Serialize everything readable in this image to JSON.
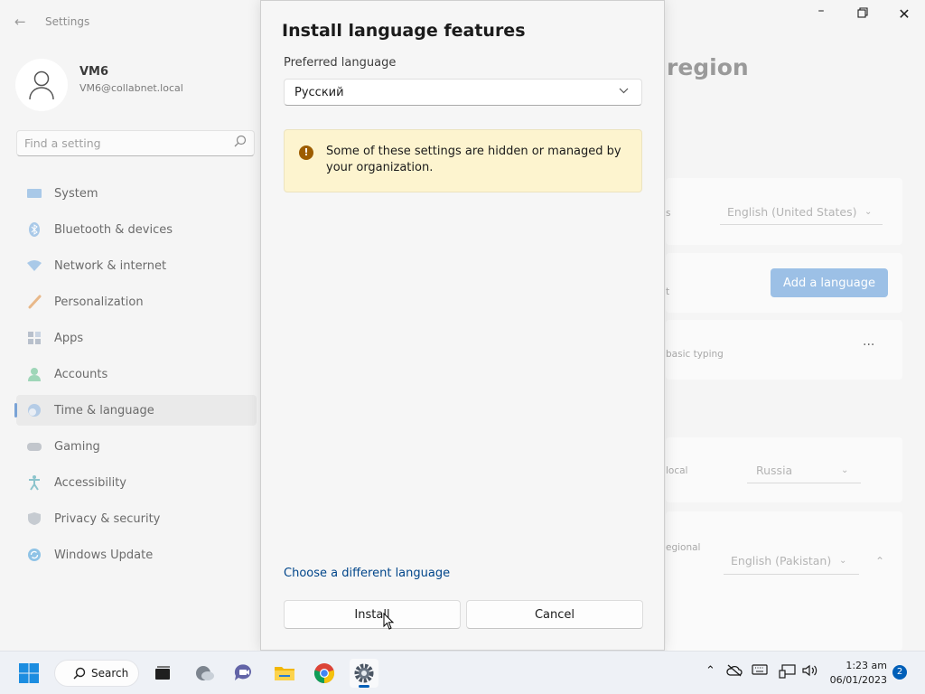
{
  "settings": {
    "app_title": "Settings",
    "user": {
      "name": "VM6",
      "email": "VM6@collabnet.local"
    },
    "search_placeholder": "Find a setting",
    "nav": [
      {
        "label": "System",
        "icon": "monitor-icon"
      },
      {
        "label": "Bluetooth & devices",
        "icon": "bluetooth-icon"
      },
      {
        "label": "Network & internet",
        "icon": "wifi-icon"
      },
      {
        "label": "Personalization",
        "icon": "brush-icon"
      },
      {
        "label": "Apps",
        "icon": "apps-icon"
      },
      {
        "label": "Accounts",
        "icon": "person-icon"
      },
      {
        "label": "Time & language",
        "icon": "globe-clock-icon",
        "active": true
      },
      {
        "label": "Gaming",
        "icon": "gamepad-icon"
      },
      {
        "label": "Accessibility",
        "icon": "accessibility-icon"
      },
      {
        "label": "Privacy & security",
        "icon": "shield-icon"
      },
      {
        "label": "Windows Update",
        "icon": "update-icon"
      }
    ],
    "page_title_fragment": "region",
    "cards": {
      "display_language_fragment": "s",
      "display_language_value": "English (United States)",
      "preferred_fragment": "t",
      "add_language_label": "Add a language",
      "language_fragment": "basic typing",
      "more": "···",
      "country_fragment": "local",
      "country_value": "Russia",
      "regional_fragment": "egional",
      "regional_value": "English (Pakistan)"
    }
  },
  "dialog": {
    "title": "Install language features",
    "preferred_label": "Preferred language",
    "selected_language": "Русский",
    "info_message": "Some of these settings are hidden or managed by your organization.",
    "choose_link": "Choose a different language",
    "install_label": "Install",
    "cancel_label": "Cancel"
  },
  "taskbar": {
    "search_label": "Search",
    "time": "1:23 am",
    "date": "06/01/2023",
    "notifications": "2"
  },
  "colors": {
    "accent": "#005fb8",
    "info_bar": "#fdf4cf",
    "warning_icon": "#9d5d00",
    "link": "#00458a"
  }
}
